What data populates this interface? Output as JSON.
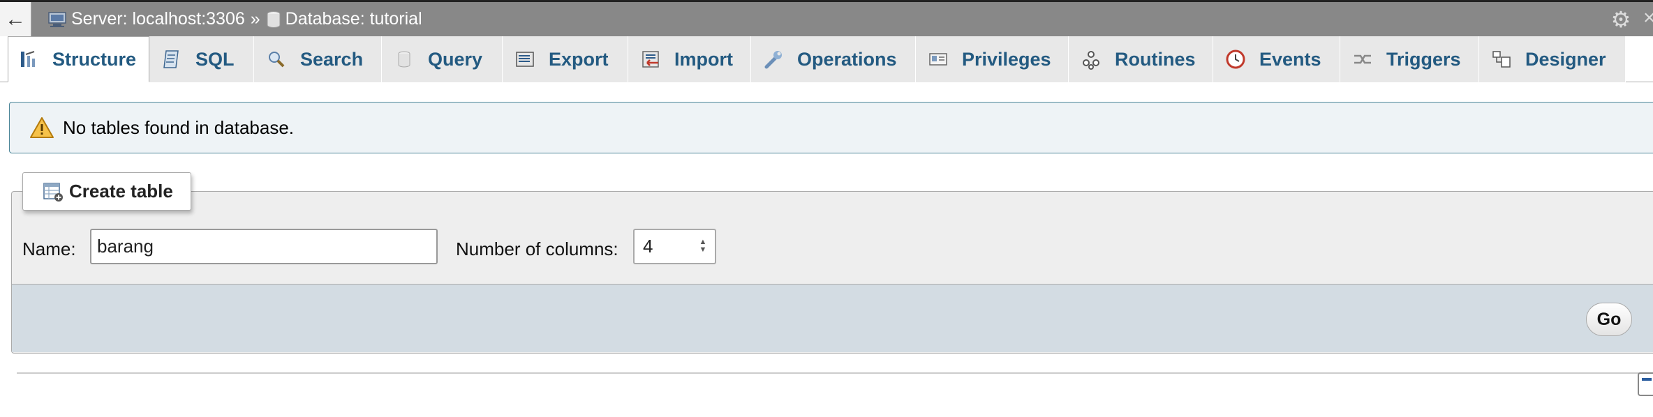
{
  "topbar": {
    "back_label": "←",
    "server_label": "Server: localhost:3306",
    "separator": "»",
    "database_label": "Database: tutorial",
    "gear_icon": "gear-icon",
    "close_glyph": "×"
  },
  "tabs": [
    {
      "label": "Structure",
      "icon": "structure-icon",
      "active": true
    },
    {
      "label": "SQL",
      "icon": "sql-icon"
    },
    {
      "label": "Search",
      "icon": "search-icon"
    },
    {
      "label": "Query",
      "icon": "query-icon"
    },
    {
      "label": "Export",
      "icon": "export-icon"
    },
    {
      "label": "Import",
      "icon": "import-icon"
    },
    {
      "label": "Operations",
      "icon": "wrench-icon"
    },
    {
      "label": "Privileges",
      "icon": "privileges-icon"
    },
    {
      "label": "Routines",
      "icon": "routines-icon"
    },
    {
      "label": "Events",
      "icon": "clock-icon"
    },
    {
      "label": "Triggers",
      "icon": "triggers-icon"
    },
    {
      "label": "Designer",
      "icon": "designer-icon"
    }
  ],
  "notice": {
    "text": "No tables found in database.",
    "icon": "warning-icon"
  },
  "create_table": {
    "legend": "Create table",
    "name_label": "Name:",
    "name_value": "barang",
    "columns_label": "Number of columns:",
    "columns_value": "4",
    "go_label": "Go"
  },
  "colors": {
    "topbar_bg": "#888888",
    "tab_text": "#235a81",
    "notice_border": "#4c8699",
    "footer_bg": "#d3dce3"
  }
}
